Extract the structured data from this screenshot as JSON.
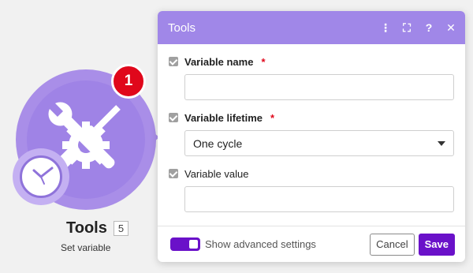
{
  "module": {
    "badge_count": "1",
    "title": "Tools",
    "id": "5",
    "subtitle": "Set variable",
    "main_icon": "tools-icon",
    "secondary_icon": "clock-icon",
    "color": "#a98ee8"
  },
  "panel": {
    "title": "Tools",
    "header_icons": [
      "more-vert-icon",
      "fullscreen-icon",
      "help-icon",
      "close-icon"
    ],
    "header_glyphs": {
      "more": "⋮",
      "fullscreen": "⛶",
      "help": "?",
      "close": "✕"
    },
    "fields": {
      "variable_name": {
        "label": "Variable name",
        "required": "*",
        "value": ""
      },
      "variable_lifetime": {
        "label": "Variable lifetime",
        "required": "*",
        "value": "One cycle"
      },
      "variable_value": {
        "label": "Variable value",
        "value": ""
      }
    },
    "advanced_settings_label": "Show advanced settings",
    "cancel_label": "Cancel",
    "save_label": "Save"
  },
  "colors": {
    "accent": "#6a11c9",
    "header": "#a087e8",
    "badge": "#e0071b"
  }
}
